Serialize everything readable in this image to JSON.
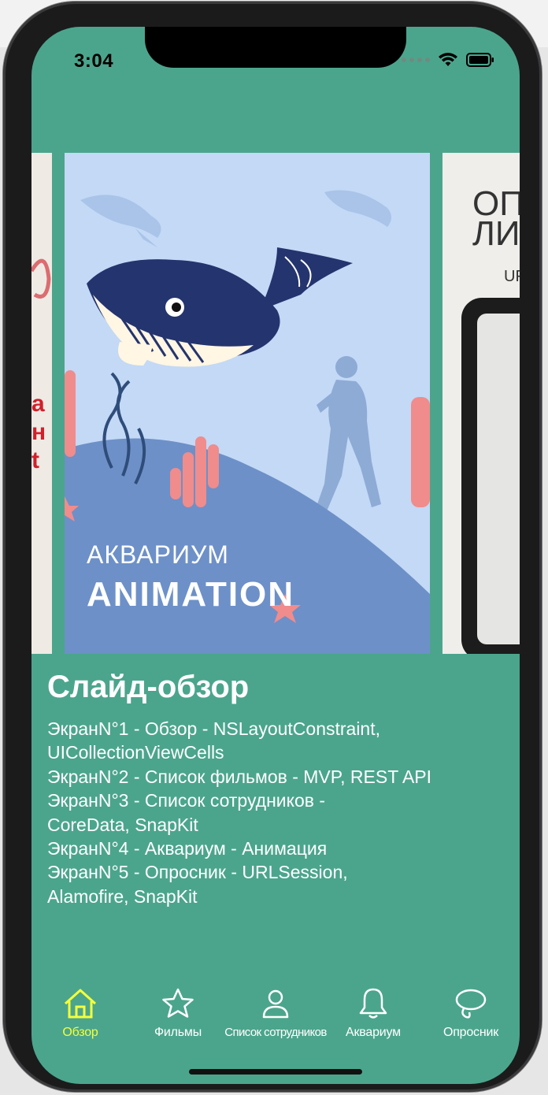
{
  "status_bar": {
    "time": "3:04"
  },
  "slides": {
    "left_card": {
      "letters": [
        "a",
        "н",
        "t"
      ]
    },
    "main_card": {
      "subtitle": "АКВАРИУМ",
      "title": "ANIMATION"
    },
    "right_card": {
      "line1": "ОП",
      "line2": "ЛИ",
      "line3": "UF"
    }
  },
  "content": {
    "title": "Слайд-обзор",
    "description": "ЭкранN°1 - Обзор - NSLayoutConstraint,\nUICollectionViewCells\nЭкранN°2 - Список фильмов - MVP, REST API\nЭкранN°3 - Список сотрудников -\nCoreData, SnapKit\nЭкранN°4 - Аквариум - Анимация\nЭкранN°5 - Опросник - URLSession,\nAlamofire, SnapKit"
  },
  "tabs": [
    {
      "label": "Обзор",
      "icon": "house-icon",
      "active": true
    },
    {
      "label": "Фильмы",
      "icon": "star-icon",
      "active": false
    },
    {
      "label": "Список сотрудников",
      "icon": "person-icon",
      "active": false
    },
    {
      "label": "Аквариум",
      "icon": "bell-icon",
      "active": false
    },
    {
      "label": "Опросник",
      "icon": "lasso-icon",
      "active": false
    }
  ],
  "colors": {
    "background": "#4ba58c",
    "active_tab": "#f4ff3a",
    "inactive_tab": "#ffffff",
    "ocean_light": "#c3d9f6",
    "whale_blue": "#24346e",
    "coral": "#f08c8c"
  }
}
